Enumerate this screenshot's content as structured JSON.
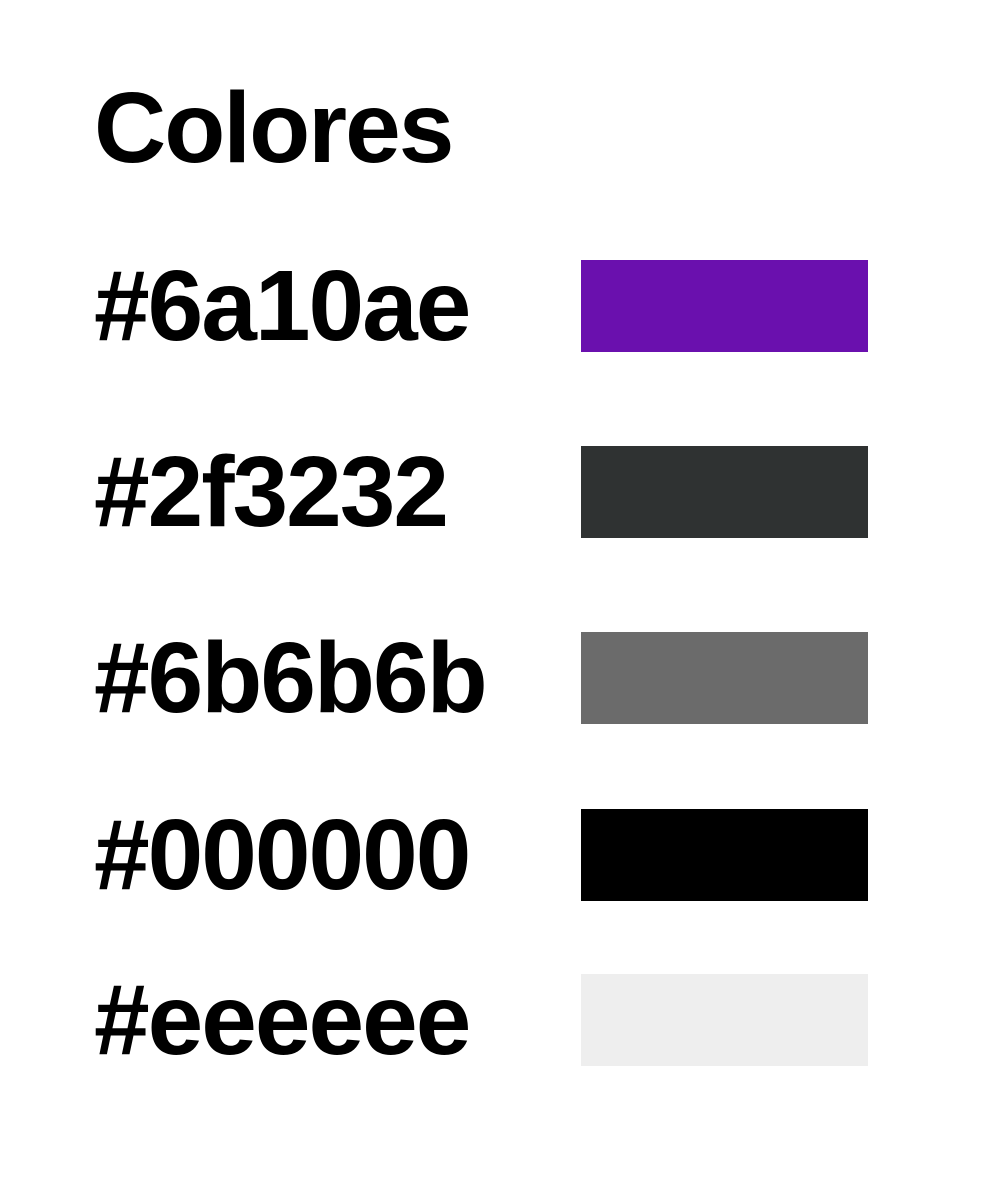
{
  "title": "Colores",
  "swatches": [
    {
      "label": "#6a10ae",
      "color": "#6a10ae"
    },
    {
      "label": "#2f3232",
      "color": "#2f3232"
    },
    {
      "label": "#6b6b6b",
      "color": "#6b6b6b"
    },
    {
      "label": "#000000",
      "color": "#000000"
    },
    {
      "label": "#eeeeee",
      "color": "#eeeeee"
    }
  ]
}
